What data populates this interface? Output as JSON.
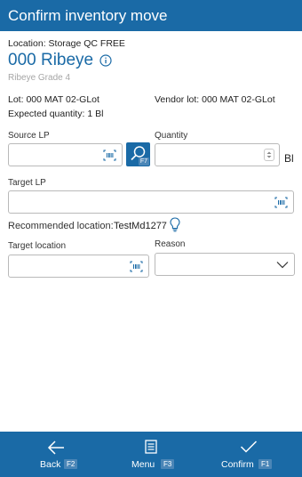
{
  "header": {
    "title": "Confirm inventory move"
  },
  "location_line": {
    "label": "Location:",
    "value": "Storage QC FREE"
  },
  "item": {
    "title": "000 Ribeye",
    "description": "Ribeye Grade 4"
  },
  "lot": {
    "label": "Lot:",
    "value": "000 MAT 02-GLot"
  },
  "vendor_lot": {
    "label": "Vendor lot:",
    "value": "000 MAT 02-GLot"
  },
  "expected_quantity": {
    "label": "Expected quantity:",
    "value": "1 Bl"
  },
  "source_lp": {
    "label": "Source LP",
    "value": "",
    "search_key": "F7"
  },
  "quantity": {
    "label": "Quantity",
    "value": "",
    "unit": "Bl"
  },
  "target_lp": {
    "label": "Target LP",
    "value": ""
  },
  "recommended_location": {
    "label": "Recommended location:",
    "value": "TestMd1277"
  },
  "target_location": {
    "label": "Target location",
    "value": ""
  },
  "reason": {
    "label": "Reason",
    "value": ""
  },
  "footer": {
    "back": {
      "label": "Back",
      "key": "F2"
    },
    "menu": {
      "label": "Menu",
      "key": "F3"
    },
    "confirm": {
      "label": "Confirm",
      "key": "F1"
    }
  },
  "colors": {
    "accent": "#1a6aa6",
    "border": "#b9b9b9",
    "muted_text": "#a6a6a6"
  }
}
